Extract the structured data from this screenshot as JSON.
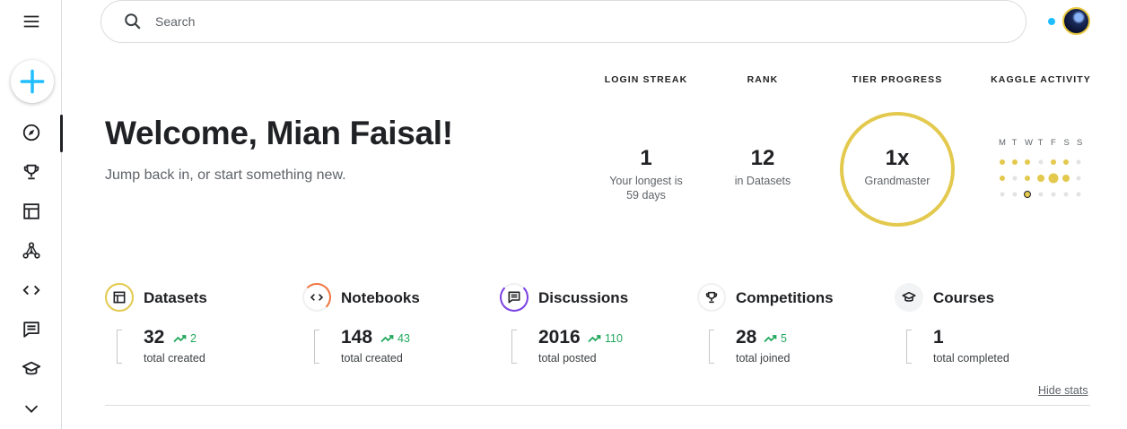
{
  "search": {
    "placeholder": "Search"
  },
  "welcome": {
    "title": "Welcome, Mian Faisal!",
    "subtitle": "Jump back in, or start something new."
  },
  "stats": {
    "login_streak": {
      "header": "LOGIN STREAK",
      "value": "1",
      "caption_line1": "Your longest is",
      "caption_line2": "59 days"
    },
    "rank": {
      "header": "RANK",
      "value": "12",
      "caption": "in Datasets"
    },
    "tier": {
      "header": "TIER PROGRESS",
      "value": "1x",
      "caption": "Grandmaster"
    },
    "activity": {
      "header": "KAGGLE ACTIVITY",
      "days": [
        "M",
        "T",
        "W",
        "T",
        "F",
        "S",
        "S"
      ]
    }
  },
  "categories": [
    {
      "title": "Datasets",
      "count": "32",
      "trend": "2",
      "label": "total created"
    },
    {
      "title": "Notebooks",
      "count": "148",
      "trend": "43",
      "label": "total created"
    },
    {
      "title": "Discussions",
      "count": "2016",
      "trend": "110",
      "label": "total posted"
    },
    {
      "title": "Competitions",
      "count": "28",
      "trend": "5",
      "label": "total joined"
    },
    {
      "title": "Courses",
      "count": "1",
      "trend": "",
      "label": "total completed"
    }
  ],
  "hide_stats_label": "Hide stats",
  "colors": {
    "accent": "#20beff",
    "gold": "#e3c94d",
    "trend_green": "#20a85c",
    "notebook_orange": "#f0743d",
    "discussion_purple": "#7b3fe4"
  },
  "icons": [
    "menu-icon",
    "plus-icon",
    "compass-icon",
    "trophy-icon",
    "table-icon",
    "models-icon",
    "code-icon",
    "discussion-icon",
    "school-icon",
    "chevron-down-icon",
    "search-icon"
  ]
}
